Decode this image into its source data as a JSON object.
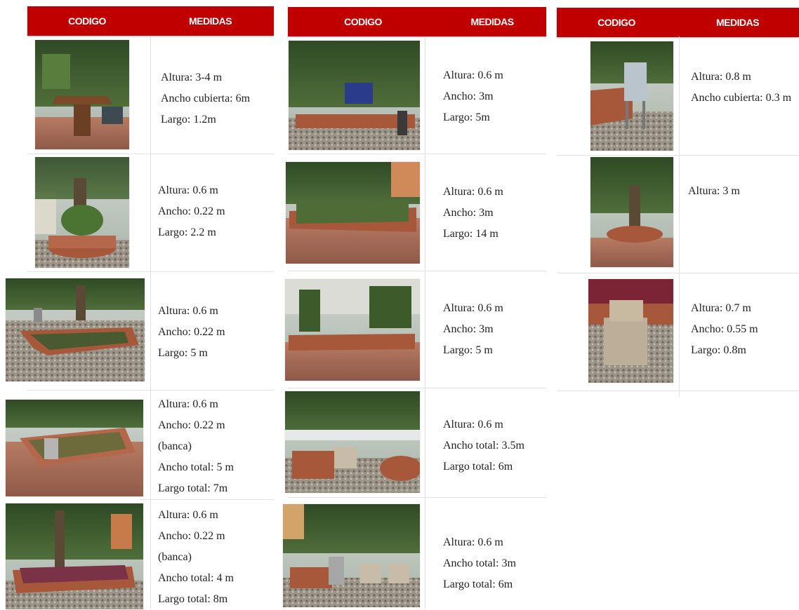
{
  "headers": {
    "col1": {
      "code": "CODIGO",
      "measures": "MEDIDAS"
    },
    "col2": {
      "code": "CODIGO",
      "measures": "MEDIDAS"
    },
    "col3": {
      "code": "CODIGO",
      "measures": "MEDIDAS"
    }
  },
  "col1": [
    {
      "lines": [
        "Altura: 3-4 m",
        "Ancho cubierta: 6m",
        "Largo: 1.2m"
      ]
    },
    {
      "lines": [
        "Altura: 0.6 m",
        "Ancho: 0.22 m",
        "Largo: 2.2 m"
      ]
    },
    {
      "lines": [
        "Altura: 0.6 m",
        "Ancho: 0.22 m",
        "Largo: 5 m"
      ]
    },
    {
      "lines": [
        "Altura: 0.6 m",
        "Ancho: 0.22 m",
        "(banca)",
        "Ancho total: 5 m",
        "Largo total: 7m"
      ]
    },
    {
      "lines": [
        "Altura: 0.6 m",
        "Ancho: 0.22 m",
        "(banca)",
        "Ancho total: 4 m",
        "Largo total: 8m"
      ]
    }
  ],
  "col2": [
    {
      "lines": [
        "Altura: 0.6 m",
        "Ancho: 3m",
        "Largo: 5m"
      ]
    },
    {
      "lines": [
        "Altura: 0.6 m",
        "Ancho: 3m",
        "Largo: 14 m"
      ]
    },
    {
      "lines": [
        "Altura: 0.6 m",
        "Ancho:  3m",
        "Largo: 5 m"
      ]
    },
    {
      "lines": [
        "Altura: 0.6 m",
        "Ancho total: 3.5m",
        "Largo total: 6m"
      ]
    },
    {
      "lines": [
        "Altura: 0.6 m",
        "Ancho total: 3m",
        "Largo total: 6m"
      ]
    }
  ],
  "col3": [
    {
      "lines": [
        "Altura: 0.8 m",
        "Ancho  cubierta:  0.3 m"
      ]
    },
    {
      "lines": [
        "Altura: 3 m"
      ]
    },
    {
      "lines": [
        "Altura: 0.7 m",
        "Ancho: 0.55 m",
        "Largo: 0.8m"
      ]
    }
  ]
}
